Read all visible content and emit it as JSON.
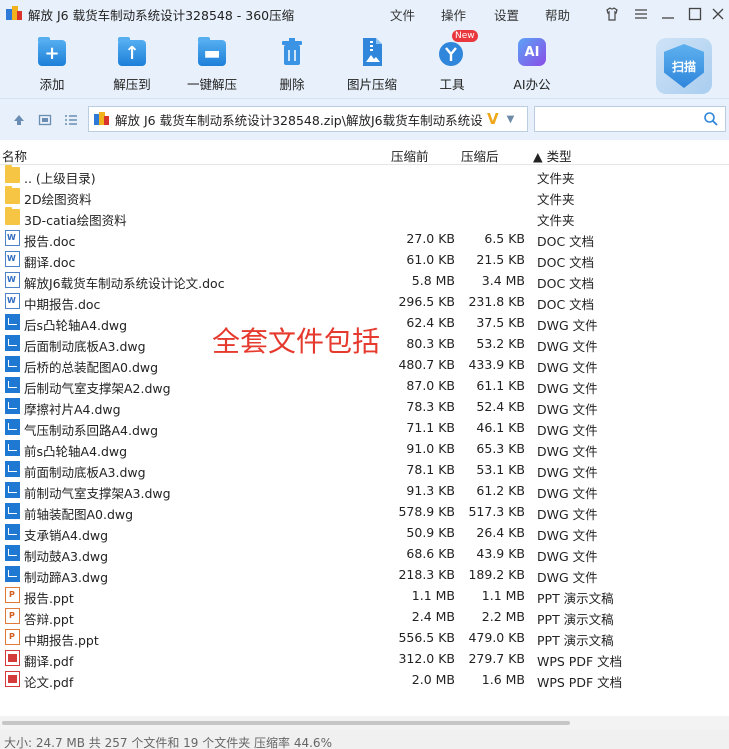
{
  "window": {
    "title": "解放 J6 载货车制动系统设计328548 - 360压缩",
    "menu": [
      "文件",
      "操作",
      "设置",
      "帮助"
    ]
  },
  "toolbar": {
    "items": [
      {
        "label": "添加",
        "icon": "add-icon"
      },
      {
        "label": "解压到",
        "icon": "extract-to-icon"
      },
      {
        "label": "一键解压",
        "icon": "one-click-extract-icon"
      },
      {
        "label": "删除",
        "icon": "delete-icon"
      },
      {
        "label": "图片压缩",
        "icon": "image-compress-icon"
      },
      {
        "label": "工具",
        "icon": "tools-icon",
        "badge": "New"
      },
      {
        "label": "AI办公",
        "icon": "ai-office-icon",
        "glyph": "AI"
      }
    ],
    "scan_label": "扫描"
  },
  "address": {
    "path": "解放 J6 载货车制动系统设计328548.zip\\解放J6载货车制动系统设计",
    "search_placeholder": ""
  },
  "columns": {
    "name": "名称",
    "compressed": "压缩前",
    "uncompressed": "压缩后",
    "type": "▲ 类型"
  },
  "files": [
    {
      "name": ".. (上级目录)",
      "before": "",
      "after": "",
      "type": "文件夹",
      "kind": "folder"
    },
    {
      "name": "2D绘图资料",
      "before": "",
      "after": "",
      "type": "文件夹",
      "kind": "folder"
    },
    {
      "name": "3D-catia绘图资料",
      "before": "",
      "after": "",
      "type": "文件夹",
      "kind": "folder"
    },
    {
      "name": "报告.doc",
      "before": "27.0 KB",
      "after": "6.5 KB",
      "type": "DOC 文档",
      "kind": "doc"
    },
    {
      "name": "翻译.doc",
      "before": "61.0 KB",
      "after": "21.5 KB",
      "type": "DOC 文档",
      "kind": "doc"
    },
    {
      "name": "解放J6载货车制动系统设计论文.doc",
      "before": "5.8 MB",
      "after": "3.4 MB",
      "type": "DOC 文档",
      "kind": "doc"
    },
    {
      "name": "中期报告.doc",
      "before": "296.5 KB",
      "after": "231.8 KB",
      "type": "DOC 文档",
      "kind": "doc"
    },
    {
      "name": "后s凸轮轴A4.dwg",
      "before": "62.4 KB",
      "after": "37.5 KB",
      "type": "DWG 文件",
      "kind": "dwg"
    },
    {
      "name": "后面制动底板A3.dwg",
      "before": "80.3 KB",
      "after": "53.2 KB",
      "type": "DWG 文件",
      "kind": "dwg"
    },
    {
      "name": "后桥的总装配图A0.dwg",
      "before": "480.7 KB",
      "after": "433.9 KB",
      "type": "DWG 文件",
      "kind": "dwg"
    },
    {
      "name": "后制动气室支撑架A2.dwg",
      "before": "87.0 KB",
      "after": "61.1 KB",
      "type": "DWG 文件",
      "kind": "dwg"
    },
    {
      "name": "摩擦衬片A4.dwg",
      "before": "78.3 KB",
      "after": "52.4 KB",
      "type": "DWG 文件",
      "kind": "dwg"
    },
    {
      "name": "气压制动系回路A4.dwg",
      "before": "71.1 KB",
      "after": "46.1 KB",
      "type": "DWG 文件",
      "kind": "dwg"
    },
    {
      "name": "前s凸轮轴A4.dwg",
      "before": "91.0 KB",
      "after": "65.3 KB",
      "type": "DWG 文件",
      "kind": "dwg"
    },
    {
      "name": "前面制动底板A3.dwg",
      "before": "78.1 KB",
      "after": "53.1 KB",
      "type": "DWG 文件",
      "kind": "dwg"
    },
    {
      "name": "前制动气室支撑架A3.dwg",
      "before": "91.3 KB",
      "after": "61.2 KB",
      "type": "DWG 文件",
      "kind": "dwg"
    },
    {
      "name": "前轴装配图A0.dwg",
      "before": "578.9 KB",
      "after": "517.3 KB",
      "type": "DWG 文件",
      "kind": "dwg"
    },
    {
      "name": "支承销A4.dwg",
      "before": "50.9 KB",
      "after": "26.4 KB",
      "type": "DWG 文件",
      "kind": "dwg"
    },
    {
      "name": "制动鼓A3.dwg",
      "before": "68.6 KB",
      "after": "43.9 KB",
      "type": "DWG 文件",
      "kind": "dwg"
    },
    {
      "name": "制动蹄A3.dwg",
      "before": "218.3 KB",
      "after": "189.2 KB",
      "type": "DWG 文件",
      "kind": "dwg"
    },
    {
      "name": "报告.ppt",
      "before": "1.1 MB",
      "after": "1.1 MB",
      "type": "PPT 演示文稿",
      "kind": "ppt"
    },
    {
      "name": "答辩.ppt",
      "before": "2.4 MB",
      "after": "2.2 MB",
      "type": "PPT 演示文稿",
      "kind": "ppt"
    },
    {
      "name": "中期报告.ppt",
      "before": "556.5 KB",
      "after": "479.0 KB",
      "type": "PPT 演示文稿",
      "kind": "ppt"
    },
    {
      "name": "翻译.pdf",
      "before": "312.0 KB",
      "after": "279.7 KB",
      "type": "WPS PDF 文档",
      "kind": "pdf"
    },
    {
      "name": "论文.pdf",
      "before": "2.0 MB",
      "after": "1.6 MB",
      "type": "WPS PDF 文档",
      "kind": "pdf"
    }
  ],
  "watermark": "全套文件包括",
  "status": "大小: 24.7 MB 共 257 个文件和 19 个文件夹 压缩率 44.6%",
  "colors": {
    "accent": "#1f78d1",
    "watermark": "#e63a2e",
    "chrome": "#e8f1fb"
  }
}
